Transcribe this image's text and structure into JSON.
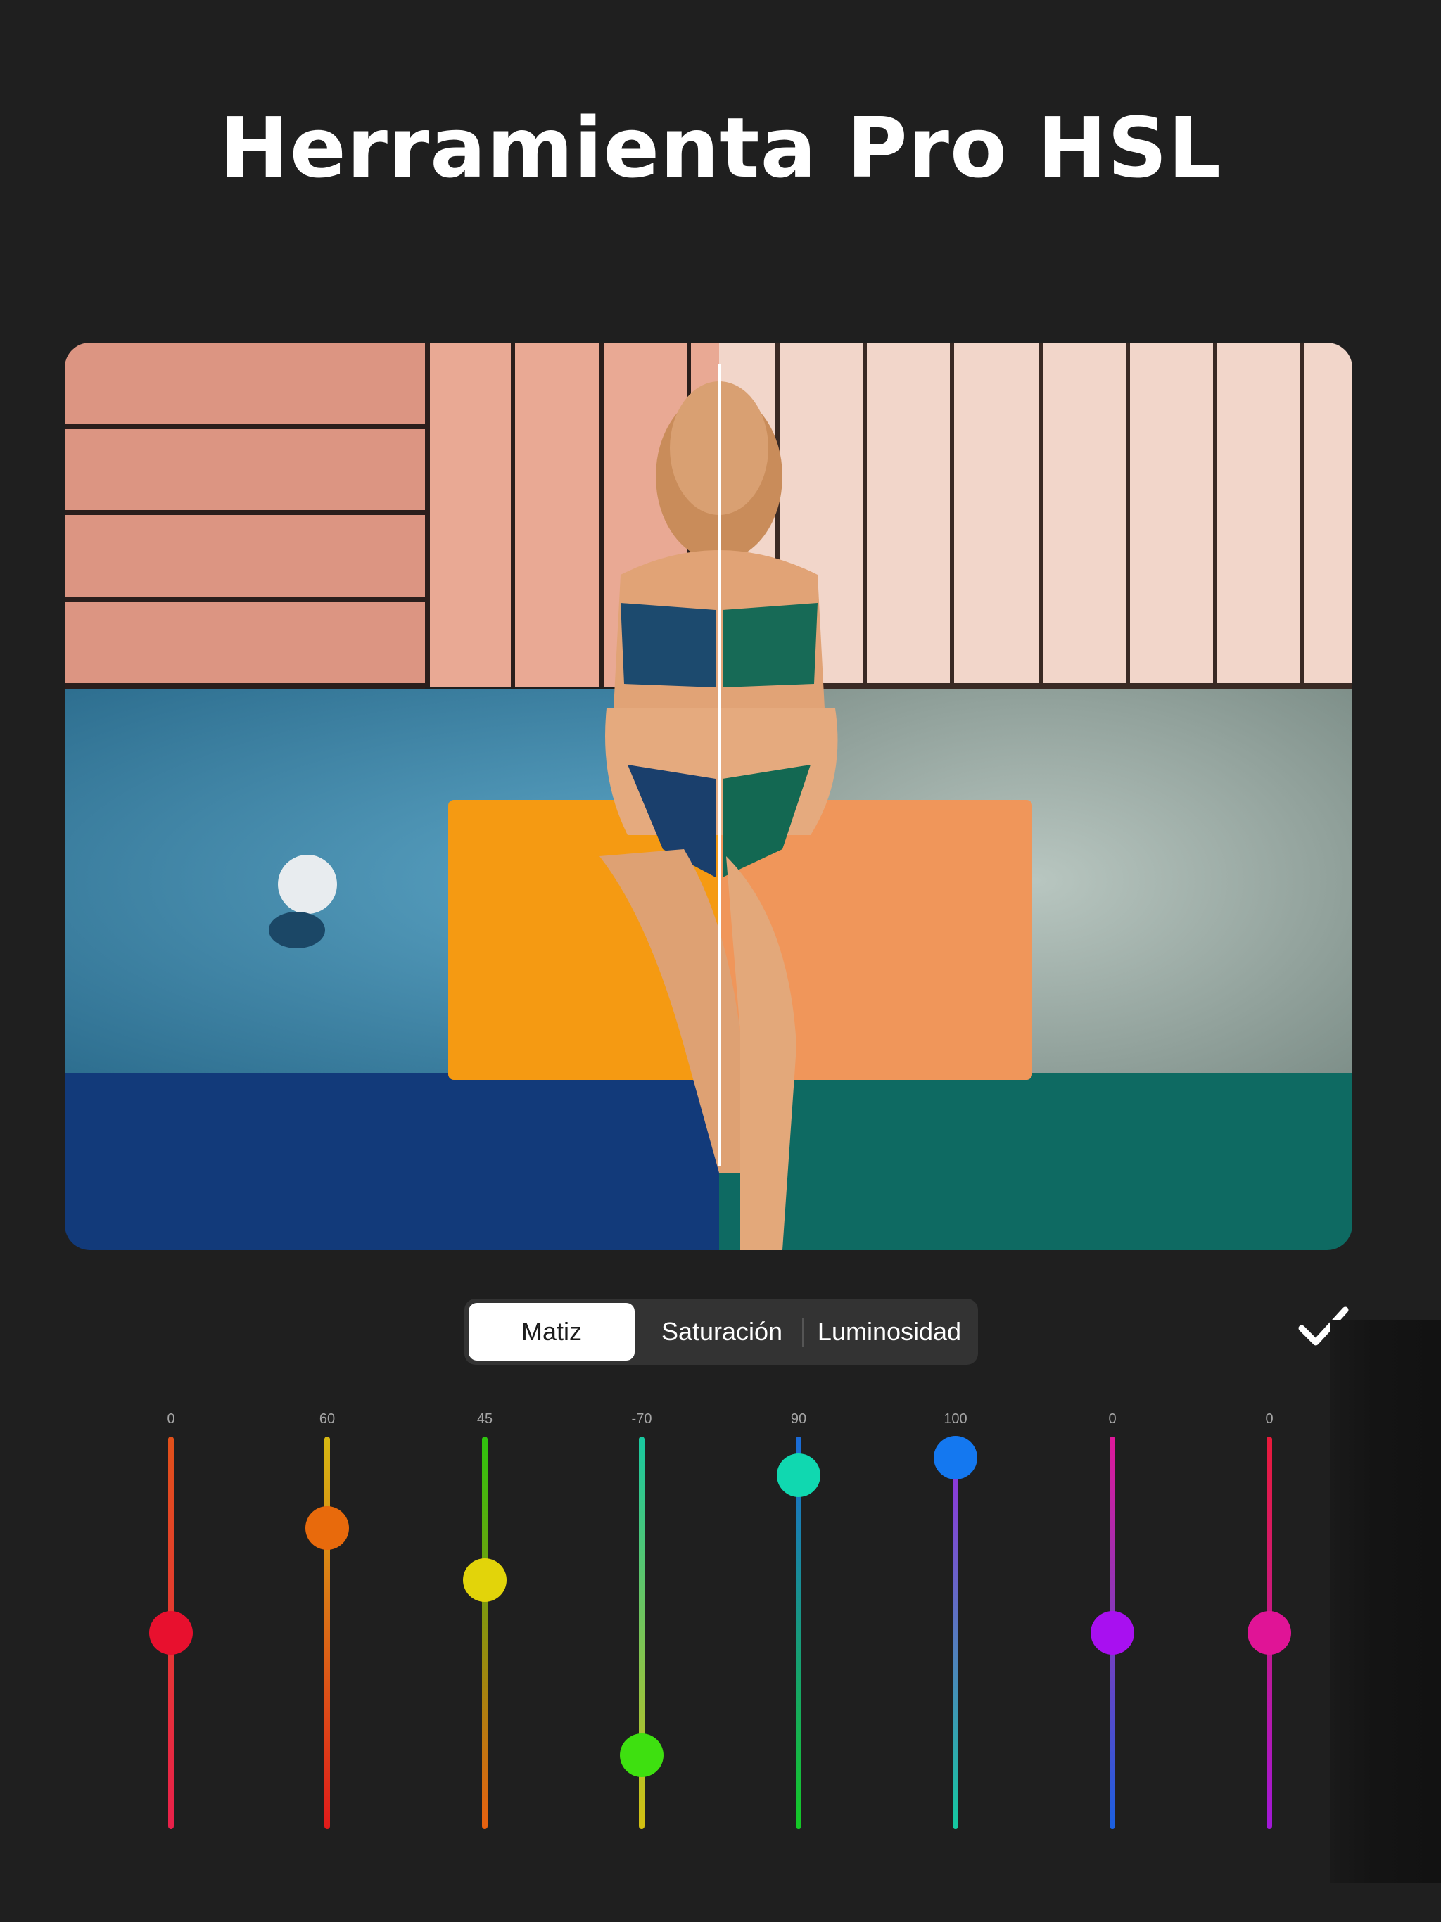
{
  "header": {
    "title": "Herramienta Pro HSL"
  },
  "tabs": [
    {
      "label": "Matiz",
      "active": true
    },
    {
      "label": "Saturación",
      "active": false
    },
    {
      "label": "Luminosidad",
      "active": false
    }
  ],
  "confirm": {
    "icon": "checkmark-icon"
  },
  "sliders": [
    {
      "value": "0",
      "level": 0.5,
      "thumb": "#e8102e",
      "track_top": "#e0501a",
      "track_bottom": "#e8204a"
    },
    {
      "value": "60",
      "level": 0.8,
      "thumb": "#e86a0c",
      "track_top": "#d6b812",
      "track_bottom": "#e01a1a"
    },
    {
      "value": "45",
      "level": 0.65,
      "thumb": "#e2d40a",
      "track_top": "#2ec40e",
      "track_bottom": "#e86010"
    },
    {
      "value": "-70",
      "level": 0.15,
      "thumb": "#3ee010",
      "track_top": "#18c8a0",
      "track_bottom": "#d4c010"
    },
    {
      "value": "90",
      "level": 0.95,
      "thumb": "#10d8b0",
      "track_top": "#1a6ad8",
      "track_bottom": "#14c824"
    },
    {
      "value": "100",
      "level": 1.0,
      "thumb": "#1478f0",
      "track_top": "#9a28e0",
      "track_bottom": "#14c8a0"
    },
    {
      "value": "0",
      "level": 0.5,
      "thumb": "#a810f0",
      "track_top": "#e0189a",
      "track_bottom": "#1a60e0"
    },
    {
      "value": "0",
      "level": 0.5,
      "thumb": "#e01496",
      "track_top": "#e81a3a",
      "track_bottom": "#a018d8"
    }
  ]
}
